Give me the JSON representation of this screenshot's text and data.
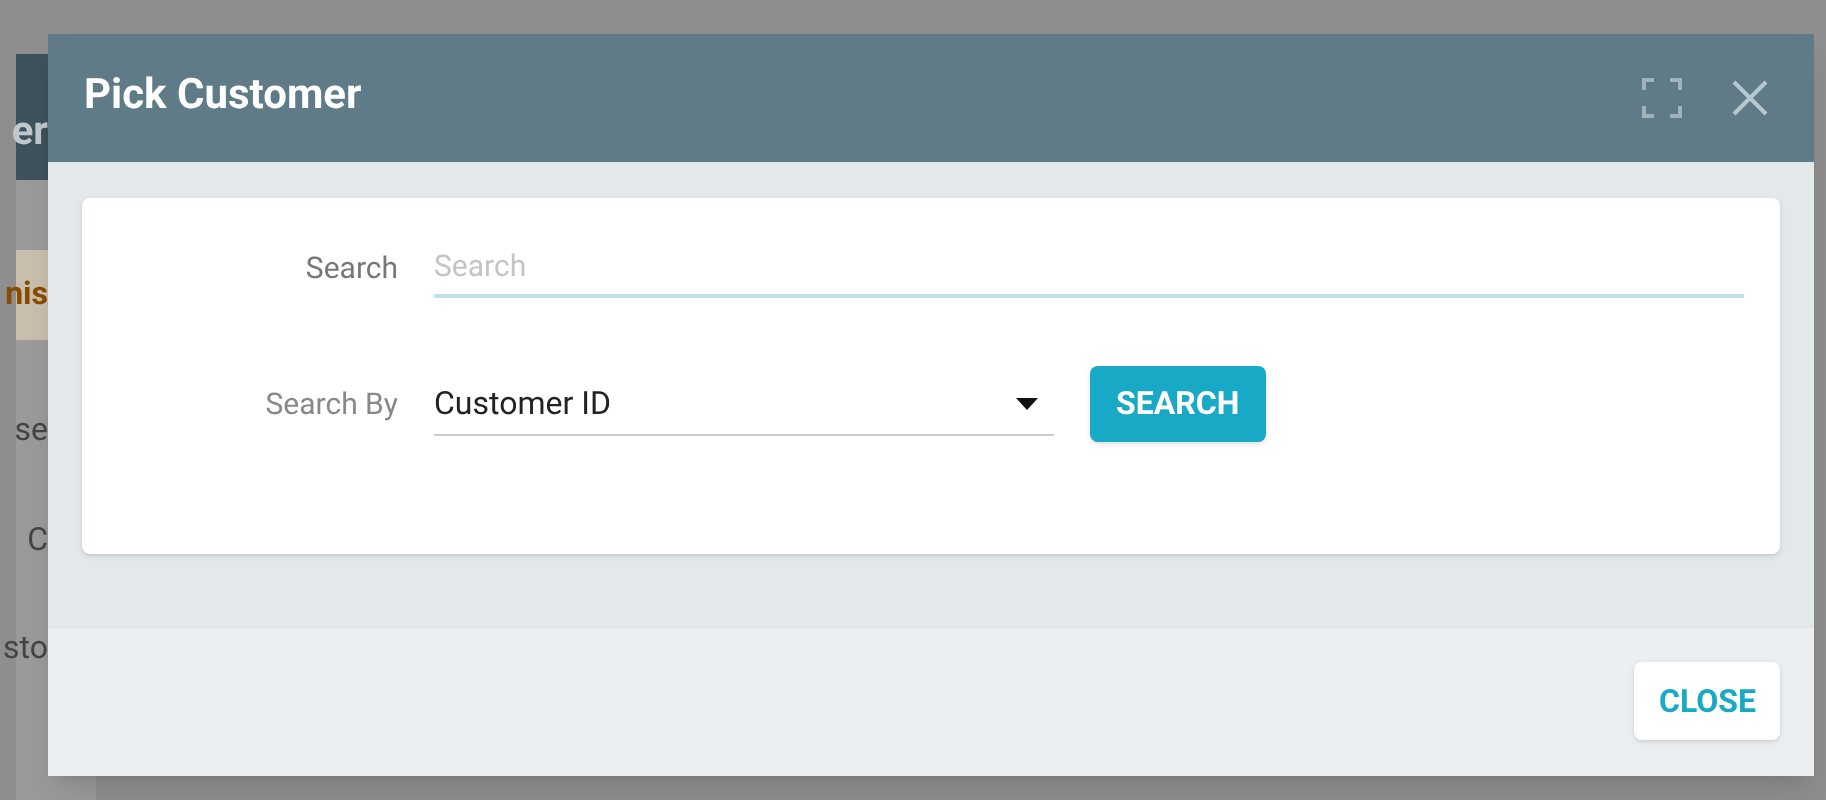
{
  "background_fragments": [
    {
      "text": "er",
      "kind": "header"
    },
    {
      "text": "nis",
      "kind": "warning"
    },
    {
      "text": "se",
      "kind": "plain"
    },
    {
      "text": "C",
      "kind": "plain"
    },
    {
      "text": "sto",
      "kind": "plain"
    }
  ],
  "dialog": {
    "title": "Pick Customer",
    "search": {
      "label": "Search",
      "placeholder": "Search"
    },
    "search_by": {
      "label": "Search By",
      "value": "Customer ID"
    },
    "search_button": "SEARCH",
    "close_button": "CLOSE"
  }
}
